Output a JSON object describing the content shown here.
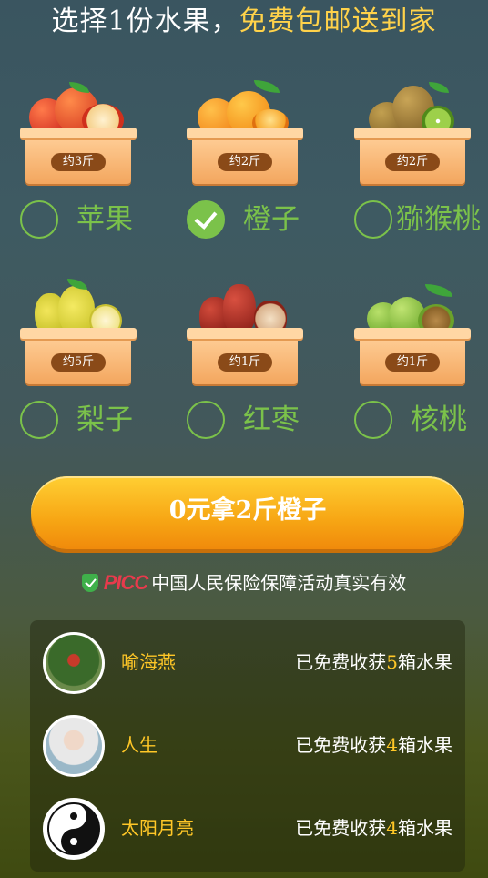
{
  "header": {
    "part1": "选择1份水果，",
    "part2": "免费包邮送到家"
  },
  "fruits": [
    {
      "name": "苹果",
      "weight": "约3斤",
      "selected": false,
      "icon": "apple-icon"
    },
    {
      "name": "橙子",
      "weight": "约2斤",
      "selected": true,
      "icon": "orange-icon"
    },
    {
      "name": "猕猴桃",
      "weight": "约2斤",
      "selected": false,
      "icon": "kiwi-icon"
    },
    {
      "name": "梨子",
      "weight": "约5斤",
      "selected": false,
      "icon": "pear-icon"
    },
    {
      "name": "红枣",
      "weight": "约1斤",
      "selected": false,
      "icon": "jujube-icon"
    },
    {
      "name": "核桃",
      "weight": "约1斤",
      "selected": false,
      "icon": "walnut-icon"
    }
  ],
  "cta": {
    "label": "0元拿2斤橙子"
  },
  "insurance": {
    "brand": "PICC",
    "text": "中国人民保险保障活动真实有效"
  },
  "records": [
    {
      "name": "喻海燕",
      "prefix": "已免费收获",
      "count": "5",
      "suffix": "箱水果"
    },
    {
      "name": "人生",
      "prefix": "已免费收获",
      "count": "4",
      "suffix": "箱水果"
    },
    {
      "name": "太阳月亮",
      "prefix": "已免费收获",
      "count": "4",
      "suffix": "箱水果"
    }
  ],
  "colors": {
    "accent_green": "#7bc24a",
    "highlight_yellow": "#ffc727",
    "cta_orange": "#f7a614"
  }
}
